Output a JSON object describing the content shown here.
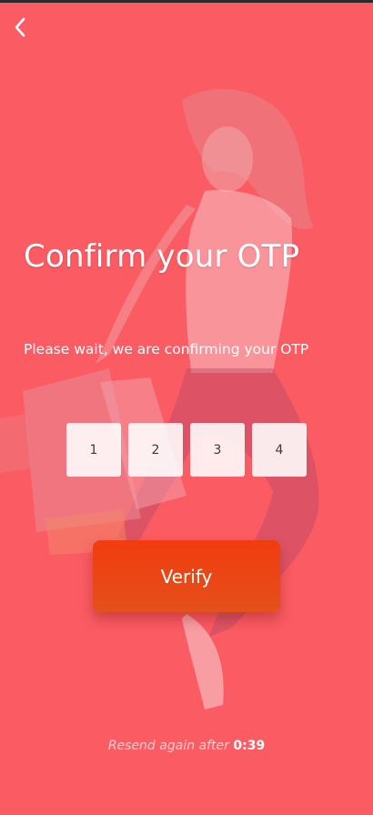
{
  "header": {
    "back_icon": "chevron-left-icon"
  },
  "main": {
    "title": "Confirm your OTP",
    "subtitle": "Please wait, we are confirming your OTP",
    "otp_digits": [
      "1",
      "2",
      "3",
      "4"
    ],
    "verify_label": "Verify"
  },
  "footer": {
    "resend_label": "Resend again after",
    "resend_timer": "0:39"
  },
  "colors": {
    "background": "#fb5b62",
    "button": "#f23c10",
    "text": "#ffffff"
  }
}
